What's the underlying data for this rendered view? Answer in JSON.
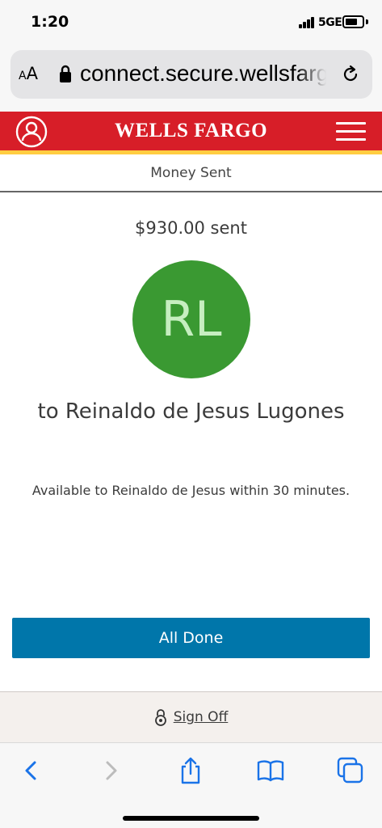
{
  "status_bar": {
    "time": "1:20",
    "network": "5GE",
    "battery_level": 0.75
  },
  "browser": {
    "text_size_small": "A",
    "text_size_large": "A",
    "url": "connect.secure.wellsfargo.com",
    "icons": [
      "lock-icon",
      "reload-icon",
      "back-icon",
      "forward-icon",
      "share-icon",
      "bookmarks-icon",
      "tabs-icon"
    ]
  },
  "header": {
    "brand": "WELLS FARGO",
    "icons": [
      "profile-icon",
      "menu-icon"
    ]
  },
  "page": {
    "title": "Money Sent",
    "amount_text": "$930.00 sent",
    "avatar_initials": "RL",
    "recipient_text": "to Reinaldo de Jesus Lugones",
    "availability_text": "Available to Reinaldo de Jesus within 30 minutes.",
    "done_button_label": "All Done"
  },
  "footer": {
    "signoff_label": "Sign Off"
  },
  "colors": {
    "brand_red": "#d71e28",
    "brand_gold": "#ffcd41",
    "avatar_green": "#3a9932",
    "button_blue": "#0076aa",
    "ios_blue": "#1a73e8"
  }
}
